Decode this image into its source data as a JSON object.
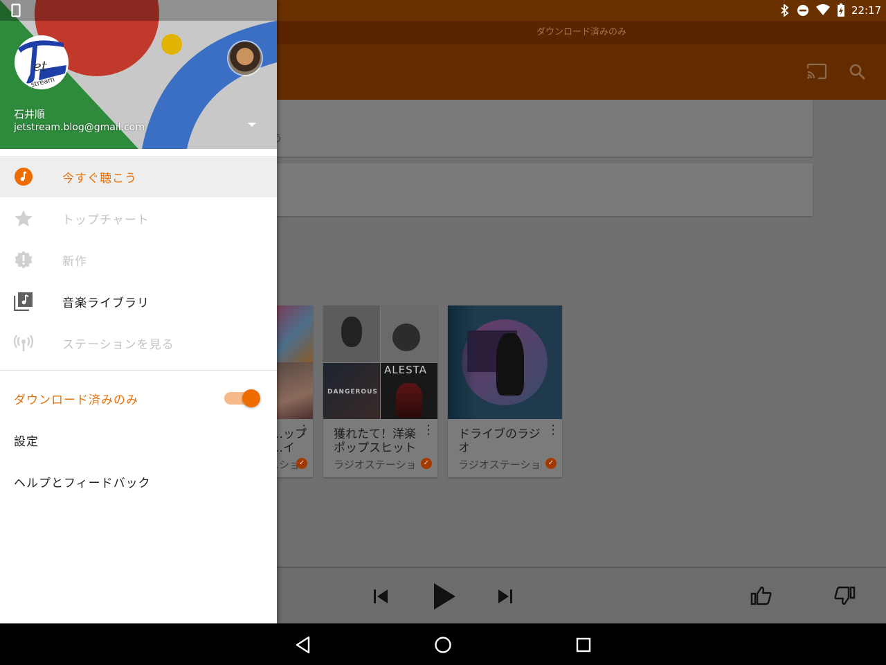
{
  "status_bar": {
    "time": "22:17"
  },
  "app": {
    "offline_banner": "ダウンロード済みのみ",
    "card_snippet": "う",
    "tiles": [
      {
        "title": "…ップ\n…イ",
        "subtitle": "…ショ"
      },
      {
        "title": "獲れたて！洋楽\nポップスヒット",
        "subtitle": "ラジオステーショ",
        "art_labels": [
          "ALESTA",
          "DANGEROUS"
        ]
      },
      {
        "title": "ドライブのラジ\nオ",
        "subtitle": "ラジオステーショ"
      }
    ]
  },
  "drawer": {
    "user_name": "石井順",
    "user_email": "jetstream.blog@gmail.com",
    "nav_items": [
      {
        "label": "今すぐ聴こう",
        "icon": "music-note-icon",
        "state": "selected"
      },
      {
        "label": "トップチャート",
        "icon": "star-icon",
        "state": "disabled"
      },
      {
        "label": "新作",
        "icon": "new-release-badge-icon",
        "state": "disabled"
      },
      {
        "label": "音楽ライブラリ",
        "icon": "music-library-icon",
        "state": "normal"
      },
      {
        "label": "ステーションを見る",
        "icon": "radio-broadcast-icon",
        "state": "disabled"
      }
    ],
    "downloaded_only": {
      "label": "ダウンロード済みのみ",
      "on": true
    },
    "settings_label": "設定",
    "help_label": "ヘルプとフィードバック"
  },
  "colors": {
    "accent": "#ef6c00",
    "toolbar": "#632c00",
    "header_red": "#c0392b",
    "header_green": "#2e8b3c",
    "header_blue": "#3a6fc4",
    "header_yellow": "#e1b200"
  }
}
